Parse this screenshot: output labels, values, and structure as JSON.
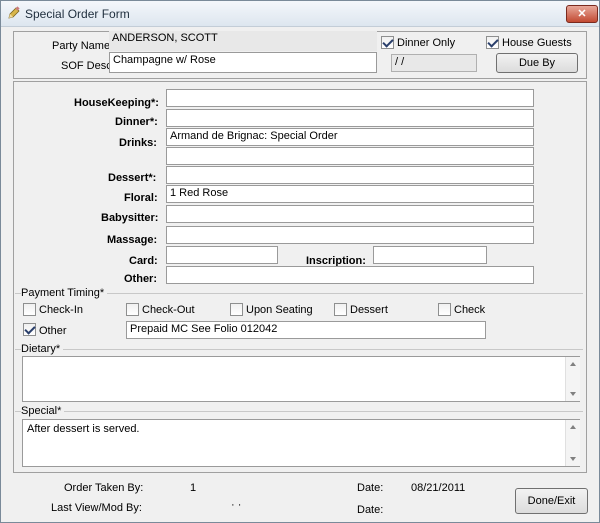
{
  "window": {
    "title": "Special Order Form",
    "close_glyph": "✕"
  },
  "header": {
    "party_name_label": "Party Name:",
    "party_name_value": "ANDERSON, SCOTT",
    "sof_desc_label": "SOF Desc:",
    "sof_desc_value": "Champagne w/ Rose",
    "dinner_only_label": "Dinner Only",
    "dinner_only_checked": true,
    "house_guests_label": "House Guests",
    "house_guests_checked": true,
    "due_date_value": "/ /",
    "due_by_label": "Due By"
  },
  "fields": {
    "housekeeping_label": "HouseKeeping*:",
    "housekeeping_value": "",
    "dinner_label": "Dinner*:",
    "dinner_value": "",
    "drinks_label": "Drinks:",
    "drinks_value": "Armand de Brignac: Special Order",
    "drinks_value2": "",
    "dessert_label": "Dessert*:",
    "dessert_value": "",
    "floral_label": "Floral:",
    "floral_value": "1 Red Rose",
    "babysitter_label": "Babysitter:",
    "babysitter_value": "",
    "massage_label": "Massage:",
    "massage_value": "",
    "card_label": "Card:",
    "card_value": "",
    "inscription_label": "Inscription:",
    "inscription_value": "",
    "other_label": "Other:",
    "other_value": ""
  },
  "payment": {
    "group_label": "Payment Timing*",
    "check_in_label": "Check-In",
    "check_out_label": "Check-Out",
    "upon_seating_label": "Upon Seating",
    "dessert_label": "Dessert",
    "check_label": "Check",
    "other_label": "Other",
    "other_checked": true,
    "other_value": "Prepaid MC See Folio 012042"
  },
  "dietary": {
    "group_label": "Dietary*",
    "value": ""
  },
  "special": {
    "group_label": "Special*",
    "value": "After dessert is served."
  },
  "footer": {
    "order_taken_by_label": "Order Taken By:",
    "order_taken_by_value": "1",
    "date_label": "Date:",
    "date_value": "08/21/2011",
    "last_view_label": "Last View/Mod By:",
    "last_view_value": "· ·",
    "date2_label": "Date:",
    "done_exit_label": "Done/Exit"
  }
}
